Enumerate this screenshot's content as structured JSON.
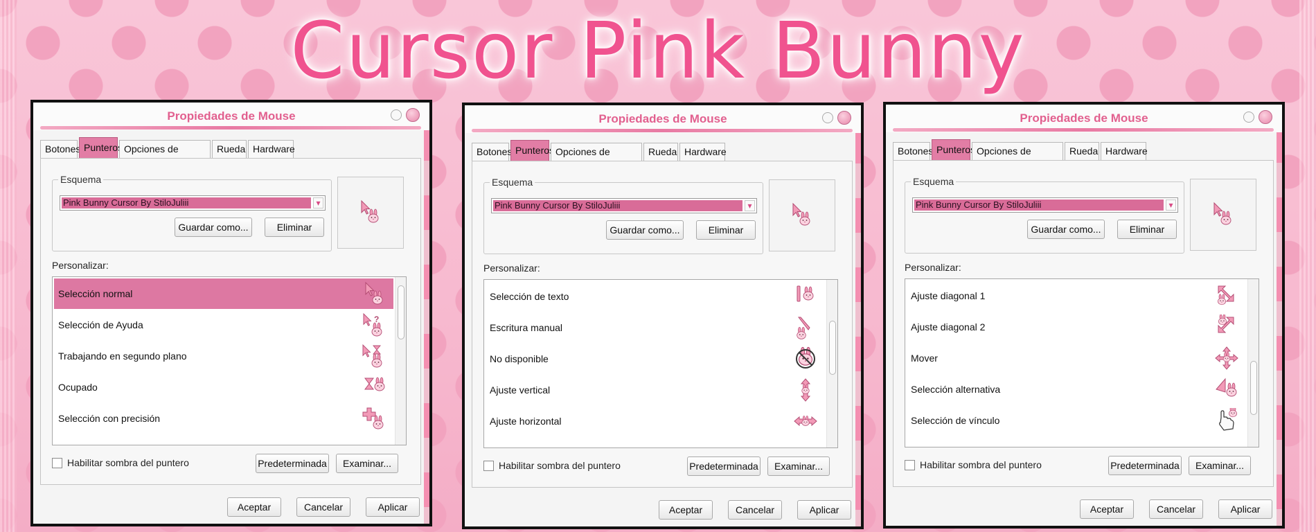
{
  "page": {
    "title": "Cursor Pink Bunny"
  },
  "colors": {
    "accent": "#e27da5",
    "title_pink": "#f0538f",
    "selection": "#dd78a2"
  },
  "windows": [
    {
      "title": "Propiedades de Mouse",
      "tabs": [
        "Botones",
        "Punteros",
        "Opciones de puntero",
        "Rueda",
        "Hardware"
      ],
      "active_tab": "Punteros",
      "scheme_label": "Esquema",
      "scheme_value": "Pink Bunny Cursor By StiloJuliii",
      "save_as": "Guardar como...",
      "delete": "Eliminar",
      "customize_label": "Personalizar:",
      "rows": [
        {
          "label": "Selección normal",
          "icon": "arrow-bunny-icon",
          "selected": true
        },
        {
          "label": "Selección de Ayuda",
          "icon": "help-bunny-icon",
          "selected": false
        },
        {
          "label": "Trabajando en segundo plano",
          "icon": "working-bunny-icon",
          "selected": false
        },
        {
          "label": "Ocupado",
          "icon": "hourglass-bunny-icon",
          "selected": false
        },
        {
          "label": "Selección con precisión",
          "icon": "crosshair-bunny-icon",
          "selected": false
        }
      ],
      "scroll_position": 0.05,
      "shadow_label": "Habilitar sombra del puntero",
      "default_btn": "Predeterminada",
      "browse_btn": "Examinar...",
      "ok": "Aceptar",
      "cancel": "Cancelar",
      "apply": "Aplicar"
    },
    {
      "title": "Propiedades de Mouse",
      "tabs": [
        "Botones",
        "Punteros",
        "Opciones de puntero",
        "Rueda",
        "Hardware"
      ],
      "active_tab": "Punteros",
      "scheme_label": "Esquema",
      "scheme_value": "Pink Bunny Cursor By StiloJuliii",
      "save_as": "Guardar como...",
      "delete": "Eliminar",
      "customize_label": "Personalizar:",
      "rows": [
        {
          "label": "Selección de texto",
          "icon": "text-bunny-icon",
          "selected": false
        },
        {
          "label": "Escritura manual",
          "icon": "pen-bunny-icon",
          "selected": false
        },
        {
          "label": "No disponible",
          "icon": "unavailable-bunny-icon",
          "selected": false
        },
        {
          "label": "Ajuste vertical",
          "icon": "resize-vertical-icon",
          "selected": false
        },
        {
          "label": "Ajuste horizontal",
          "icon": "resize-horizontal-icon",
          "selected": false
        }
      ],
      "scroll_position": 0.35,
      "shadow_label": "Habilitar sombra del puntero",
      "default_btn": "Predeterminada",
      "browse_btn": "Examinar...",
      "ok": "Aceptar",
      "cancel": "Cancelar",
      "apply": "Aplicar"
    },
    {
      "title": "Propiedades de Mouse",
      "tabs": [
        "Botones",
        "Punteros",
        "Opciones de puntero",
        "Rueda",
        "Hardware"
      ],
      "active_tab": "Punteros",
      "scheme_label": "Esquema",
      "scheme_value": "Pink Bunny Cursor By StiloJuliii",
      "save_as": "Guardar como...",
      "delete": "Eliminar",
      "customize_label": "Personalizar:",
      "rows": [
        {
          "label": "Ajuste diagonal 1",
          "icon": "resize-diagonal-1-icon",
          "selected": false
        },
        {
          "label": "Ajuste diagonal 2",
          "icon": "resize-diagonal-2-icon",
          "selected": false
        },
        {
          "label": "Mover",
          "icon": "move-icon",
          "selected": false
        },
        {
          "label": "Selección alternativa",
          "icon": "alternate-bunny-icon",
          "selected": false
        },
        {
          "label": "Selección de vínculo",
          "icon": "hand-bunny-icon",
          "selected": false
        }
      ],
      "scroll_position": 0.72,
      "shadow_label": "Habilitar sombra del puntero",
      "default_btn": "Predeterminada",
      "browse_btn": "Examinar...",
      "ok": "Aceptar",
      "cancel": "Cancelar",
      "apply": "Aplicar"
    }
  ]
}
